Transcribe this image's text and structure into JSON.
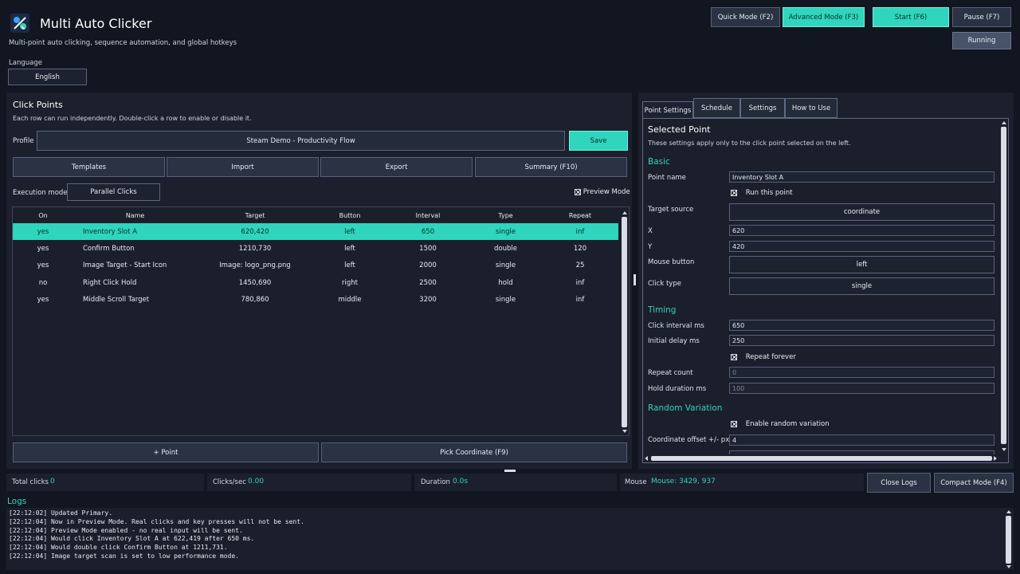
{
  "app": {
    "title": "Multi Auto Clicker",
    "subtitle": "Multi-point auto clicking, sequence automation, and global hotkeys",
    "language_label": "Language",
    "language_value": "English"
  },
  "header_buttons": {
    "quick_mode": "Quick Mode (F2)",
    "advanced_mode": "Advanced Mode (F3)",
    "start": "Start (F6)",
    "pause": "Pause (F7)",
    "status": "Running"
  },
  "click_points": {
    "title": "Click Points",
    "description": "Each row can run independently. Double-click a row to enable or disable it.",
    "profile_label": "Profile",
    "profile_value": "Steam Demo - Productivity Flow",
    "save": "Save",
    "templates": "Templates",
    "import": "Import",
    "export": "Export",
    "summary": "Summary (F10)",
    "execution_mode_label": "Execution mode",
    "execution_mode_value": "Parallel Clicks",
    "preview_mode": "Preview Mode",
    "columns": [
      "On",
      "Name",
      "Target",
      "Button",
      "Interval",
      "Type",
      "Repeat"
    ],
    "rows": [
      {
        "on": "yes",
        "name": "Inventory Slot A",
        "target": "620,420",
        "button": "left",
        "interval": "650",
        "type": "single",
        "repeat": "inf"
      },
      {
        "on": "yes",
        "name": "Confirm Button",
        "target": "1210,730",
        "button": "left",
        "interval": "1500",
        "type": "double",
        "repeat": "120"
      },
      {
        "on": "yes",
        "name": "Image Target - Start Icon",
        "target": "Image: logo_png.png",
        "button": "left",
        "interval": "2000",
        "type": "single",
        "repeat": "25"
      },
      {
        "on": "no",
        "name": "Right Click Hold",
        "target": "1450,690",
        "button": "right",
        "interval": "2500",
        "type": "hold",
        "repeat": "inf"
      },
      {
        "on": "yes",
        "name": "Middle Scroll Target",
        "target": "780,860",
        "button": "middle",
        "interval": "3200",
        "type": "single",
        "repeat": "inf"
      }
    ],
    "add_point": "+ Point",
    "pick_coordinate": "Pick Coordinate (F9)"
  },
  "tabs": [
    "Point Settings",
    "Schedule",
    "Settings",
    "How to Use"
  ],
  "point_settings": {
    "title": "Selected Point",
    "description": "These settings apply only to the click point selected on the left.",
    "basic_title": "Basic",
    "point_name_label": "Point name",
    "point_name_value": "Inventory Slot A",
    "run_this_point": "Run this point",
    "target_source_label": "Target source",
    "target_source_value": "coordinate",
    "x_label": "X",
    "x_value": "620",
    "y_label": "Y",
    "y_value": "420",
    "mouse_button_label": "Mouse button",
    "mouse_button_value": "left",
    "click_type_label": "Click type",
    "click_type_value": "single",
    "timing_title": "Timing",
    "click_interval_label": "Click interval ms",
    "click_interval_value": "650",
    "initial_delay_label": "Initial delay ms",
    "initial_delay_value": "250",
    "repeat_forever": "Repeat forever",
    "repeat_count_label": "Repeat count",
    "repeat_count_value": "0",
    "hold_duration_label": "Hold duration ms",
    "hold_duration_value": "100",
    "random_title": "Random Variation",
    "enable_random": "Enable random variation",
    "coord_offset_label": "Coordinate offset +/- px",
    "coord_offset_value": "4"
  },
  "stats": {
    "total_clicks_label": "Total clicks",
    "total_clicks_value": "0",
    "clicks_sec_label": "Clicks/sec",
    "clicks_sec_value": "0.00",
    "duration_label": "Duration",
    "duration_value": "0.0s",
    "mouse_label": "Mouse",
    "mouse_value": "Mouse: 3429, 937",
    "close_logs": "Close Logs",
    "compact_mode": "Compact Mode (F4)"
  },
  "logs": {
    "title": "Logs",
    "lines": [
      "[22:12:02] Updated Primary.",
      "[22:12:04] Now in Preview Mode. Real clicks and key presses will not be sent.",
      "[22:12:04] Preview Mode enabled - no real input will be sent.",
      "[22:12:04] Would click Inventory Slot A at 622,419 after 650 ms.",
      "[22:12:04] Would double click Confirm Button at 1211,731.",
      "[22:12:04] Image target scan is set to low performance mode."
    ]
  },
  "colors": {
    "accent": "#2fd5bd",
    "background": "#111620",
    "panel": "#1b202c"
  }
}
